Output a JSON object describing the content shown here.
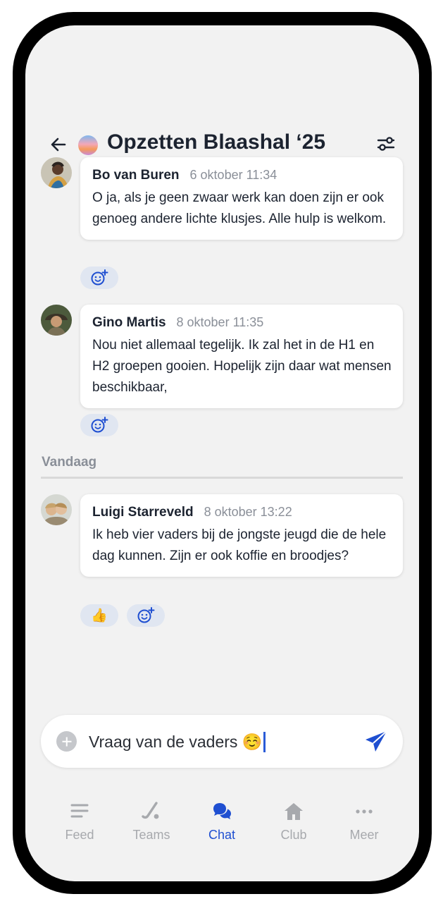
{
  "header": {
    "title": "Opzetten Blaashal ‘25",
    "back_icon": "arrow-left-icon",
    "filter_icon": "sliders-icon"
  },
  "messages": [
    {
      "author": "Bo van Buren",
      "time": "6 oktober 11:34",
      "text": "O ja, als je geen zwaar werk kan doen zijn er ook genoeg andere lichte klusjes. Alle hulp is welkom.",
      "reactions": []
    },
    {
      "author": "Gino Martis",
      "time": "8 oktober 11:35",
      "text": "Nou niet allemaal tegelijk. Ik zal het in de H1 en H2 groepen gooien. Hopelijk zijn daar wat mensen beschikbaar,",
      "reactions": []
    },
    {
      "author": "Luigi Starreveld",
      "time": "8 oktober 13:22",
      "text": "Ik heb vier vaders bij de jongste jeugd die de hele dag kunnen. Zijn er ook koffie en broodjes?",
      "reactions": [
        {
          "emoji": "👍"
        }
      ]
    }
  ],
  "divider": {
    "label": "Vandaag"
  },
  "composer": {
    "value": "Vraag van de vaders ☺️",
    "add_icon": "plus-circle-icon",
    "send_icon": "send-icon"
  },
  "tabs": [
    {
      "label": "Feed",
      "icon": "feed-icon",
      "active": false
    },
    {
      "label": "Teams",
      "icon": "hockey-icon",
      "active": false
    },
    {
      "label": "Chat",
      "icon": "chat-icon",
      "active": true
    },
    {
      "label": "Club",
      "icon": "home-icon",
      "active": false
    },
    {
      "label": "Meer",
      "icon": "more-icon",
      "active": false
    }
  ],
  "colors": {
    "accent": "#1f4fd1",
    "background": "#f2f2f2",
    "reaction_bg": "#e0e6f1"
  }
}
